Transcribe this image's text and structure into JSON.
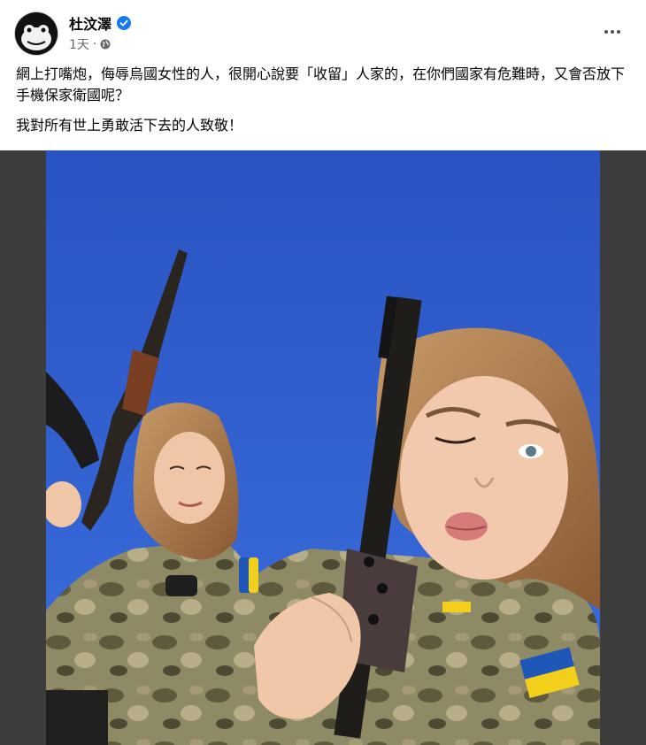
{
  "post": {
    "author": "杜汶澤",
    "timestamp": "1天",
    "audience_icon": "globe-icon",
    "verified_icon": "verified-badge-icon",
    "paragraphs": [
      "網上打嘴炮，侮辱烏國女性的人，很開心說要「收留」人家的，在你們國家有危難時，又會否放下手機保家衛國呢？",
      "我對所有世上勇敢活下去的人致敬！"
    ]
  },
  "photo": {
    "subject": "two women in camouflage uniforms with rifles against blue sky"
  },
  "colors": {
    "verified_blue": "#1877f2",
    "sky": "#2c56c8",
    "camo": "#7a7553",
    "flag_blue": "#1f57b8",
    "flag_yellow": "#f2cf1b"
  }
}
